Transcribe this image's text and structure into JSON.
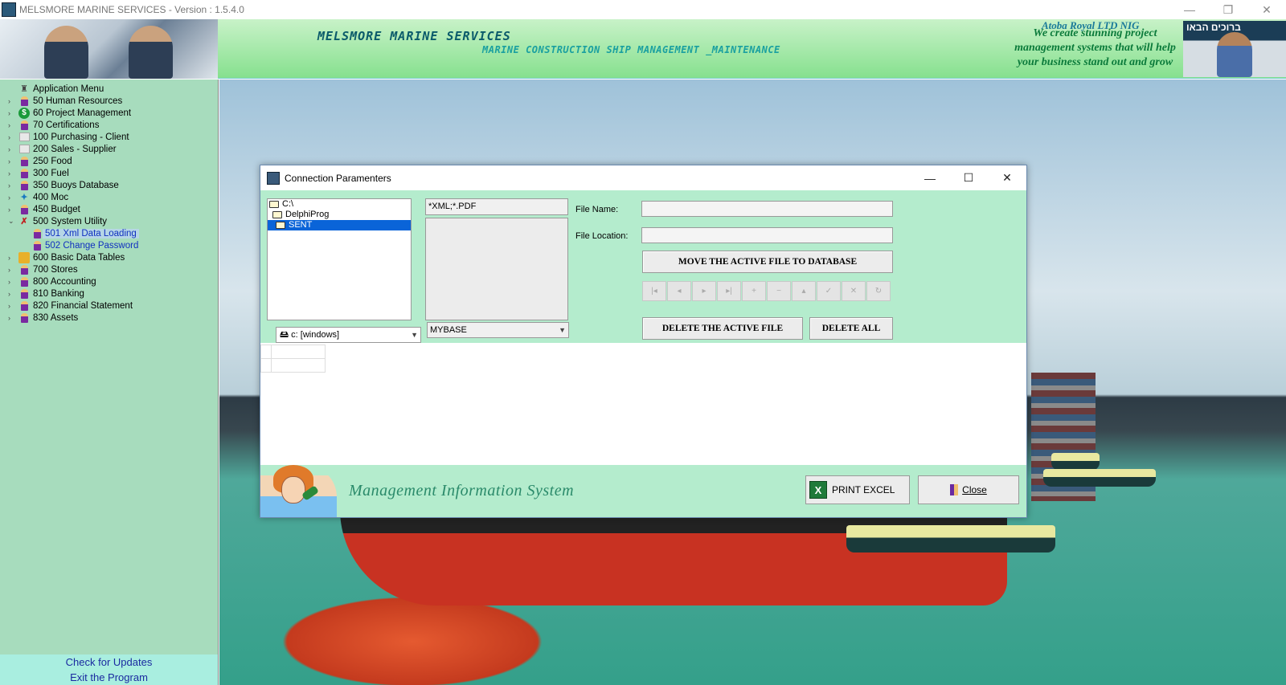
{
  "window": {
    "title": "MELSMORE MARINE SERVICES - Version : 1.5.4.0",
    "controls": [
      "—",
      "❐",
      "✕"
    ]
  },
  "header": {
    "company": "MELSMORE MARINE SERVICES",
    "tagline": "MARINE CONSTRUCTION SHIP MANAGEMENT _MAINTENANCE",
    "promo_title": "Atoba Royal LTD NIG",
    "promo_text": "We create stunning project management systems that will help your business stand out and grow",
    "photo_right_text": "ברוכים הבאו"
  },
  "sidebar": {
    "items": [
      {
        "label": "Application Menu",
        "icon": "menu-icon",
        "expander": ""
      },
      {
        "label": "50  Human Resources",
        "icon": "person-icon",
        "expander": "›"
      },
      {
        "label": "60  Project Management",
        "icon": "dollar-icon",
        "expander": "›"
      },
      {
        "label": "70  Certifications",
        "icon": "person-icon",
        "expander": "›"
      },
      {
        "label": "100  Purchasing  - Client",
        "icon": "doc-icon",
        "expander": "›"
      },
      {
        "label": "200  Sales - Supplier",
        "icon": "doc-icon",
        "expander": "›"
      },
      {
        "label": "250  Food",
        "icon": "person-icon",
        "expander": "›"
      },
      {
        "label": "300  Fuel",
        "icon": "person-icon",
        "expander": "›"
      },
      {
        "label": "350  Buoys Database",
        "icon": "person-icon",
        "expander": "›"
      },
      {
        "label": "400  Moc",
        "icon": "arrow-icon",
        "expander": "›"
      },
      {
        "label": "450  Budget",
        "icon": "person-icon",
        "expander": "›"
      },
      {
        "label": "500  System Utility",
        "icon": "tools-icon",
        "expander": "⌄"
      },
      {
        "label": "501  Xml Data Loading",
        "icon": "person-icon",
        "expander": ""
      },
      {
        "label": "502  Change Password",
        "icon": "person-icon",
        "expander": ""
      },
      {
        "label": "600  Basic  Data Tables",
        "icon": "database-icon",
        "expander": "›"
      },
      {
        "label": "700  Stores",
        "icon": "person-icon",
        "expander": "›"
      },
      {
        "label": "800  Accounting",
        "icon": "person-icon",
        "expander": "›"
      },
      {
        "label": "810  Banking",
        "icon": "person-icon",
        "expander": "›"
      },
      {
        "label": "820  Financial Statement",
        "icon": "person-icon",
        "expander": "›"
      },
      {
        "label": "830  Assets",
        "icon": "person-icon",
        "expander": "›"
      }
    ],
    "footer": {
      "check_updates": "Check for Updates",
      "exit": "Exit the Program"
    }
  },
  "dialog": {
    "title": "Connection Paramenters",
    "controls": [
      "—",
      "☐",
      "✕"
    ],
    "dirs": [
      "C:\\",
      "DelphiProg",
      "SENT"
    ],
    "drive": "c: [windows]",
    "file_mask": "*XML;*.PDF",
    "database": "MYBASE",
    "file_name_label": "File Name:",
    "file_name_value": "",
    "file_location_label": "File Location:",
    "file_location_value": "",
    "move_button": "MOVE THE ACTIVE  FILE TO  DATABASE",
    "nav_buttons": [
      "|◂",
      "◂",
      "▸",
      "▸|",
      "+",
      "−",
      "▴",
      "✓",
      "✕",
      "↻"
    ],
    "delete_active_button": "DELETE THE ACTIVE FILE",
    "delete_all_button": "DELETE ALL",
    "mis_text": "Management Information System",
    "print_excel_button": "PRINT EXCEL",
    "close_button": "Close"
  }
}
